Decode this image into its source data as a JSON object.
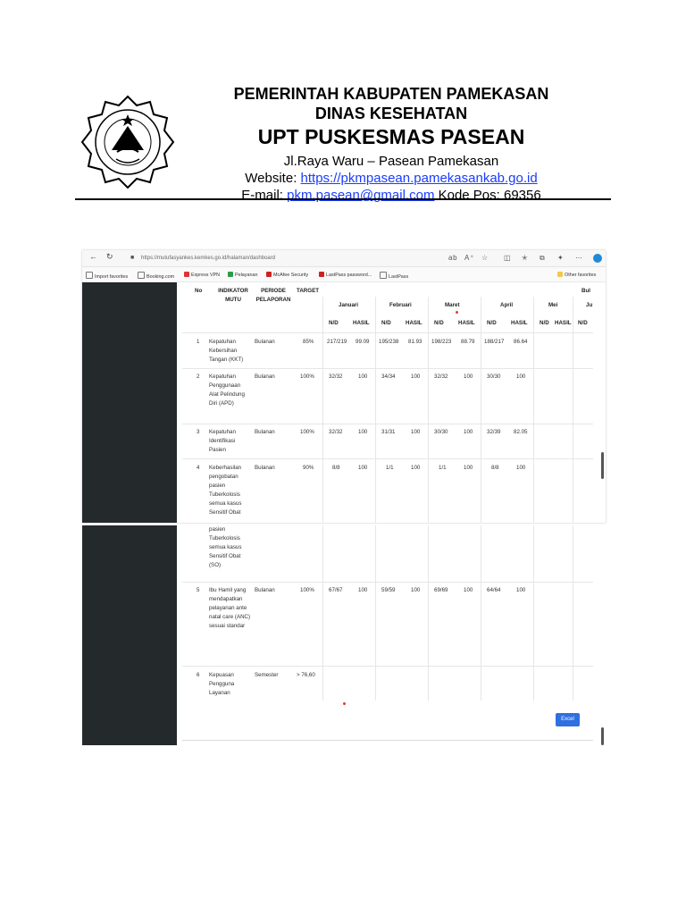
{
  "kop": {
    "line1": "PEMERINTAH KABUPATEN PAMEKASAN",
    "line2": "DINAS KESEHATAN",
    "line3": "UPT PUSKESMAS PASEAN",
    "address": "Jl.Raya Waru – Pasean Pamekasan",
    "website_label": "Website: ",
    "website": "https://pkmpasean.pamekasankab.go.id",
    "email_label": "E-mail: ",
    "email": "pkm.pasean@gmail.com",
    "postcode": " Kode Pos: 69356"
  },
  "browser": {
    "url": "https://mutufasyankes.kemkes.go.id/halaman/dashboard",
    "favorites": [
      "Import favorites",
      "Booking.com",
      "Express VPN",
      "Pelayanan",
      "McAfee Security",
      "LastPass password...",
      "LastPass"
    ],
    "other_favorites": "Other favorites"
  },
  "table": {
    "headers": {
      "no": "No",
      "indikator": "INDIKATOR MUTU",
      "periode": "PERIODE PELAPORAN",
      "target": "TARGET",
      "months": [
        "Januari",
        "Februari",
        "Maret",
        "April",
        "Mei",
        "Ju"
      ],
      "bulan": "Bul",
      "nd": "N/D",
      "hasil": "HASIL"
    },
    "rows": [
      {
        "no": "1",
        "indikator": "Kepatuhan Kebersihan Tangan (KKT)",
        "periode": "Bulanan",
        "target": "85%",
        "jan_nd": "217/219",
        "jan_h": "99.09",
        "feb_nd": "195/238",
        "feb_h": "81.93",
        "mar_nd": "198/223",
        "mar_h": "88.79",
        "apr_nd": "188/217",
        "apr_h": "86.64"
      },
      {
        "no": "2",
        "indikator": "Kepatuhan Penggunaan Alat Pelindung Diri (APD)",
        "periode": "Bulanan",
        "target": "100%",
        "jan_nd": "32/32",
        "jan_h": "100",
        "feb_nd": "34/34",
        "feb_h": "100",
        "mar_nd": "32/32",
        "mar_h": "100",
        "apr_nd": "30/30",
        "apr_h": "100"
      },
      {
        "no": "3",
        "indikator": "Kepatuhan Identifikasi Pasien",
        "periode": "Bulanan",
        "target": "100%",
        "jan_nd": "32/32",
        "jan_h": "100",
        "feb_nd": "31/31",
        "feb_h": "100",
        "mar_nd": "30/30",
        "mar_h": "100",
        "apr_nd": "32/39",
        "apr_h": "82.05"
      },
      {
        "no": "4",
        "indikator": "Keberhasilan pengobatan pasien Tuberkolosis semua kasus Sensitif Obat",
        "periode": "Bulanan",
        "target": "90%",
        "jan_nd": "8/8",
        "jan_h": "100",
        "feb_nd": "1/1",
        "feb_h": "100",
        "mar_nd": "1/1",
        "mar_h": "100",
        "apr_nd": "8/8",
        "apr_h": "100"
      }
    ],
    "row4_cont": "pasien Tuberkolosis semua kasus Sensitif Obat (SO)",
    "rows2": [
      {
        "no": "5",
        "indikator": "Ibu Hamil yang mendapatkan pelayanan ante natal care (ANC) sesuai standar",
        "periode": "Bulanan",
        "target": "100%",
        "jan_nd": "67/67",
        "jan_h": "100",
        "feb_nd": "59/59",
        "feb_h": "100",
        "mar_nd": "69/69",
        "mar_h": "100",
        "apr_nd": "64/64",
        "apr_h": "100"
      },
      {
        "no": "6",
        "indikator": "Kepuasan Pengguna Layanan",
        "periode": "Semester",
        "target": "> 76,60"
      }
    ],
    "excel": "Excel"
  }
}
